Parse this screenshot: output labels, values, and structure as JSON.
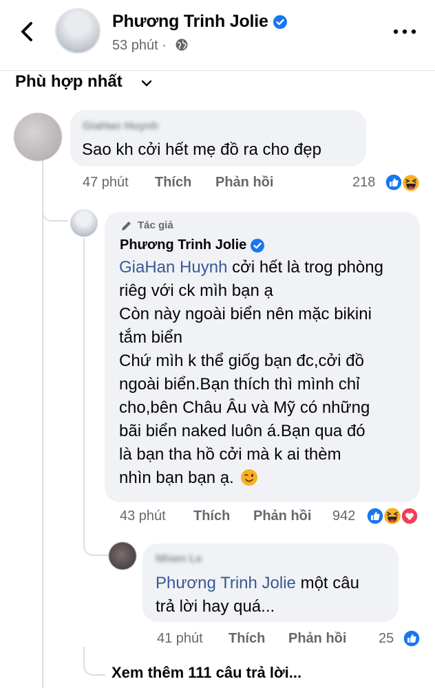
{
  "header": {
    "page_name": "Phương Trinh Jolie",
    "time": "53 phút",
    "separator": "·"
  },
  "sort": {
    "label": "Phù hợp nhất"
  },
  "comment1": {
    "author": "GiaHan Huynh",
    "text": "Sao kh cởi hết mẹ đồ ra cho đẹp",
    "time": "47 phút",
    "like": "Thích",
    "reply": "Phản hồi",
    "reactions": "218"
  },
  "reply1": {
    "author_tag": "Tác giả",
    "author": "Phương Trinh Jolie",
    "mention": "GiaHan Huynh",
    "lines": [
      " cởi hết là trog phòng",
      "riêg với ck mìh bạn ạ",
      "Còn này ngoài biển nên mặc bikini",
      "tắm biển",
      "Chứ mìh k thể giốg bạn đc,cởi đồ",
      "ngoài biển.Bạn thích thì mình chỉ",
      "cho,bên Châu Âu và Mỹ có những",
      "bãi biển naked luôn á.Bạn qua đó",
      "là bạn tha hồ cởi mà k ai thèm",
      "nhìn bạn bạn ạ."
    ],
    "time": "43 phút",
    "like": "Thích",
    "reply": "Phản hồi",
    "reactions": "942"
  },
  "reply2": {
    "author": "Nhien Le",
    "mention": "Phương Trinh Jolie",
    "text_line1": " một câu",
    "text_line2": "trả lời hay quá...",
    "time": "41 phút",
    "like": "Thích",
    "reply": "Phản hồi",
    "reactions": "25"
  },
  "more_replies": "Xem thêm 111 câu trả lời...",
  "colors": {
    "facebook_blue": "#1877f2",
    "bubble_bg": "#f0f2f5",
    "meta_gray": "#65676b",
    "mention_blue": "#385898",
    "love_red": "#f33e58",
    "haha_yellow": "#f7b125"
  },
  "icons": [
    "back-arrow-icon",
    "verified-badge-icon",
    "globe-icon",
    "more-options-icon",
    "chevron-down-icon",
    "pencil-icon",
    "like-reaction-icon",
    "haha-reaction-icon",
    "love-reaction-icon",
    "wink-emoji-icon"
  ]
}
